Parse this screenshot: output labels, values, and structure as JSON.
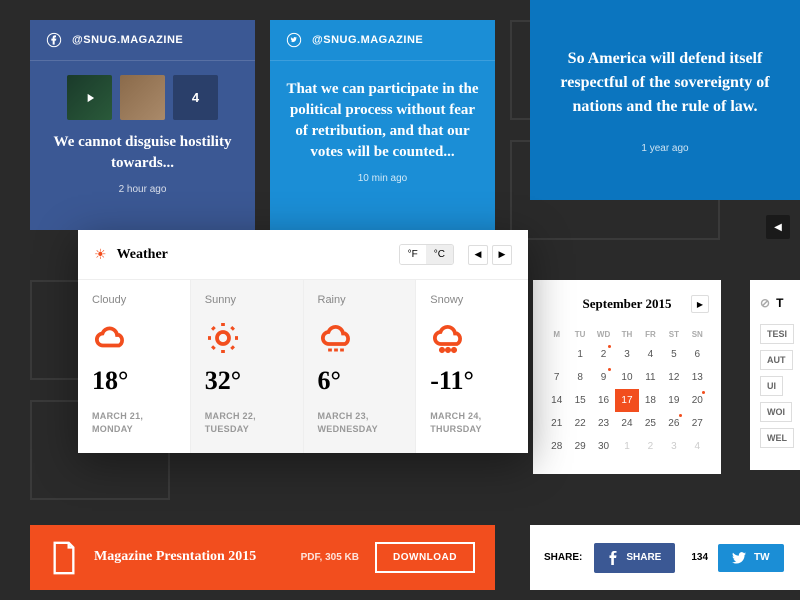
{
  "social": {
    "fb": {
      "handle": "@SNUG.MAGAZINE",
      "count": "4",
      "text": "We cannot disguise hostility towards...",
      "time": "2 hour ago"
    },
    "tw": {
      "handle": "@SNUG.MAGAZINE",
      "text": "That we can participate in the political process without fear of retribution, and that our votes will be counted...",
      "time": "10 min ago"
    },
    "quote": {
      "text": "So America will defend itself respectful of the sovereignty of nations and the rule of law.",
      "time": "1 year ago"
    }
  },
  "weather": {
    "title": "Weather",
    "units": {
      "f": "°F",
      "c": "°C"
    },
    "days": [
      {
        "cond": "Cloudy",
        "temp": "18°",
        "date": "MARCH 21, MONDAY"
      },
      {
        "cond": "Sunny",
        "temp": "32°",
        "date": "MARCH 22, TUESDAY"
      },
      {
        "cond": "Rainy",
        "temp": "6°",
        "date": "MARCH 23, WEDNESDAY"
      },
      {
        "cond": "Snowy",
        "temp": "-11°",
        "date": "MARCH 24, THURSDAY"
      }
    ]
  },
  "calendar": {
    "title": "September 2015",
    "dow": [
      "M",
      "TU",
      "WD",
      "TH",
      "FR",
      "ST",
      "SN"
    ],
    "cells": [
      {
        "n": "",
        "o": 1
      },
      {
        "n": "1"
      },
      {
        "n": "2",
        "dot": 1
      },
      {
        "n": "3"
      },
      {
        "n": "4"
      },
      {
        "n": "5"
      },
      {
        "n": "6"
      },
      {
        "n": "7"
      },
      {
        "n": "8"
      },
      {
        "n": "9",
        "dot": 1
      },
      {
        "n": "10"
      },
      {
        "n": "11"
      },
      {
        "n": "12"
      },
      {
        "n": "13"
      },
      {
        "n": "14"
      },
      {
        "n": "15"
      },
      {
        "n": "16"
      },
      {
        "n": "17",
        "sel": 1
      },
      {
        "n": "18"
      },
      {
        "n": "19"
      },
      {
        "n": "20",
        "dot": 1
      },
      {
        "n": "21"
      },
      {
        "n": "22"
      },
      {
        "n": "23"
      },
      {
        "n": "24"
      },
      {
        "n": "25"
      },
      {
        "n": "26",
        "dot": 1
      },
      {
        "n": "27"
      },
      {
        "n": "28"
      },
      {
        "n": "29"
      },
      {
        "n": "30"
      },
      {
        "n": "1",
        "o": 1
      },
      {
        "n": "2",
        "o": 1
      },
      {
        "n": "3",
        "o": 1
      },
      {
        "n": "4",
        "o": 1
      }
    ]
  },
  "tags": {
    "title": "T",
    "items": [
      "TESI",
      "AUT",
      "UI",
      "WOI",
      "WEL"
    ]
  },
  "download": {
    "title": "Magazine Presntation 2015",
    "meta": "PDF, 305 KB",
    "btn": "DOWNLOAD"
  },
  "share": {
    "label": "SHARE:",
    "fb": "SHARE",
    "count": "134",
    "tw": "TW"
  }
}
